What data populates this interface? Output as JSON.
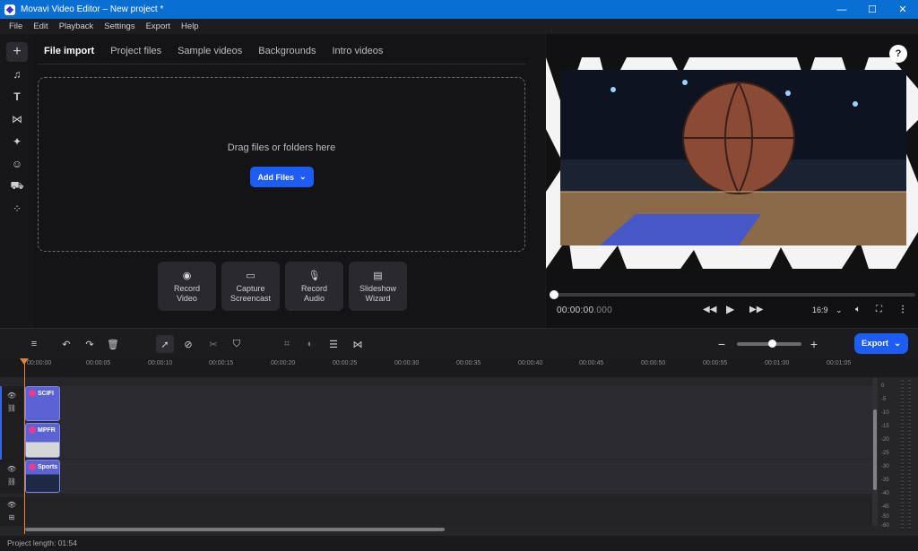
{
  "window": {
    "title": "Movavi Video Editor – New project *",
    "controls": [
      "—",
      "☐",
      "✕"
    ]
  },
  "menu": [
    "File",
    "Edit",
    "Playback",
    "Settings",
    "Export",
    "Help"
  ],
  "sidebar": {
    "icons": [
      "plus-icon",
      "music-icon",
      "text-icon",
      "transition-icon",
      "magic-wand-icon",
      "sticker-icon",
      "store-icon",
      "more-tools-icon"
    ]
  },
  "import": {
    "tabs": [
      "File import",
      "Project files",
      "Sample videos",
      "Backgrounds",
      "Intro videos"
    ],
    "drop_text": "Drag files or folders here",
    "add_files": "Add Files",
    "capture_buttons": [
      {
        "line1": "Record",
        "line2": "Video",
        "icon": "webcam-icon"
      },
      {
        "line1": "Capture",
        "line2": "Screencast",
        "icon": "monitor-icon"
      },
      {
        "line1": "Record",
        "line2": "Audio",
        "icon": "microphone-icon"
      },
      {
        "line1": "Slideshow",
        "line2": "Wizard",
        "icon": "slideshow-icon"
      }
    ]
  },
  "player": {
    "help": "?",
    "timecode_main": "00:00:00",
    "timecode_ms": ".000",
    "aspect": "16:9",
    "progress": 0
  },
  "timeline": {
    "export": "Export",
    "zoom_level": 0.55,
    "ruler": [
      "00:00:00",
      "00:00:05",
      "00:00:10",
      "00:00:15",
      "00:00:20",
      "00:00:25",
      "00:00:30",
      "00:00:35",
      "00:00:40",
      "00:00:45",
      "00:00:50",
      "00:00:55",
      "00:01:00",
      "00:01:05"
    ],
    "clips": [
      "SCIFI",
      "MPFR",
      "Sports"
    ],
    "meter_labels": [
      "0",
      "-5",
      "-10",
      "-15",
      "-20",
      "-25",
      "-30",
      "-35",
      "-40",
      "-45",
      "-50",
      "-60"
    ]
  },
  "status": {
    "project_length": "Project length: 01:54"
  },
  "colors": {
    "accent": "#1d5cf5",
    "titlebar": "#0a6fd2",
    "playhead": "#e0843a",
    "clip": "#5b62d4"
  }
}
